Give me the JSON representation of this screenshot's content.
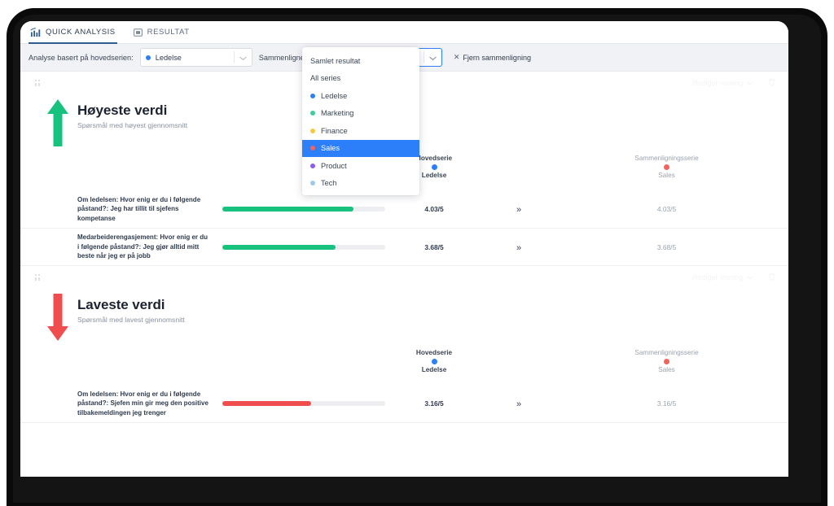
{
  "tabs": [
    {
      "label": "QUICK ANALYSIS",
      "icon": "bar-chart-icon",
      "active": true
    },
    {
      "label": "RESULTAT",
      "icon": "slide-icon",
      "active": false
    }
  ],
  "filterbar": {
    "main_label": "Analyse basert på hovedserien:",
    "main_value": "Ledelse",
    "main_color": "#2d7ff9",
    "compare_label": "Sammenligne med:",
    "compare_value": "Sales",
    "compare_color": "#f04e4e",
    "remove_label": "Fjern sammenligning",
    "remove_icon": "close-icon"
  },
  "dropdown": {
    "open": true,
    "options": [
      {
        "label": "Samlet resultat",
        "color": null,
        "selected": false
      },
      {
        "label": "All series",
        "color": null,
        "selected": false
      },
      {
        "label": "Ledelse",
        "color": "#2d7ff9",
        "selected": false
      },
      {
        "label": "Marketing",
        "color": "#3ecf9a",
        "selected": false
      },
      {
        "label": "Finance",
        "color": "#f7c93e",
        "selected": false
      },
      {
        "label": "Sales",
        "color": "#f4645f",
        "selected": true
      },
      {
        "label": "Product",
        "color": "#8b5cf6",
        "selected": false
      },
      {
        "label": "Tech",
        "color": "#9ec9e8",
        "selected": false
      }
    ]
  },
  "card_actions": {
    "edit_view_label": "Rediger visning",
    "chevron_icon": "chevron-down-icon",
    "delete_icon": "trash-icon",
    "drag_icon": "drag-handle-icon"
  },
  "columns": {
    "main_title": "Hovedserie",
    "main_series": "Ledelse",
    "main_color": "#2d7ff9",
    "compare_title": "Sammenligningsserie",
    "compare_series": "Sales",
    "compare_color": "#f4645f",
    "compare_arrow_icon": "double-chevron-right-icon"
  },
  "cards": [
    {
      "id": "highest",
      "title": "Høyeste verdi",
      "subtitle": "Spørsmål med høyest gjennomsnitt",
      "arrow_icon": "arrow-up-icon",
      "accent": "#17c27f",
      "rows": [
        {
          "question": "Om ledelsen: Hvor enig er du i følgende påstand?: Jeg har tillit til sjefens kompetanse",
          "main_value": "4.03/5",
          "compare_value": "4.03/5",
          "bar_pct": 80.6,
          "bar_color": "#17c27f"
        },
        {
          "question": "Medarbeiderengasjement: Hvor enig er du i følgende påstand?: Jeg gjør alltid mitt beste når jeg er på jobb",
          "main_value": "3.68/5",
          "compare_value": "3.68/5",
          "bar_pct": 69.5,
          "bar_color": "#17c27f"
        }
      ]
    },
    {
      "id": "lowest",
      "title": "Laveste verdi",
      "subtitle": "Spørsmål med lavest gjennomsnitt",
      "arrow_icon": "arrow-down-icon",
      "accent": "#f04e4e",
      "rows": [
        {
          "question": "Om ledelsen: Hvor enig er du i følgende påstand?: Sjefen min gir meg den positive tilbakemeldingen jeg trenger",
          "main_value": "3.16/5",
          "compare_value": "3.16/5",
          "bar_pct": 54.5,
          "bar_color": "#f04e4e"
        }
      ]
    }
  ]
}
